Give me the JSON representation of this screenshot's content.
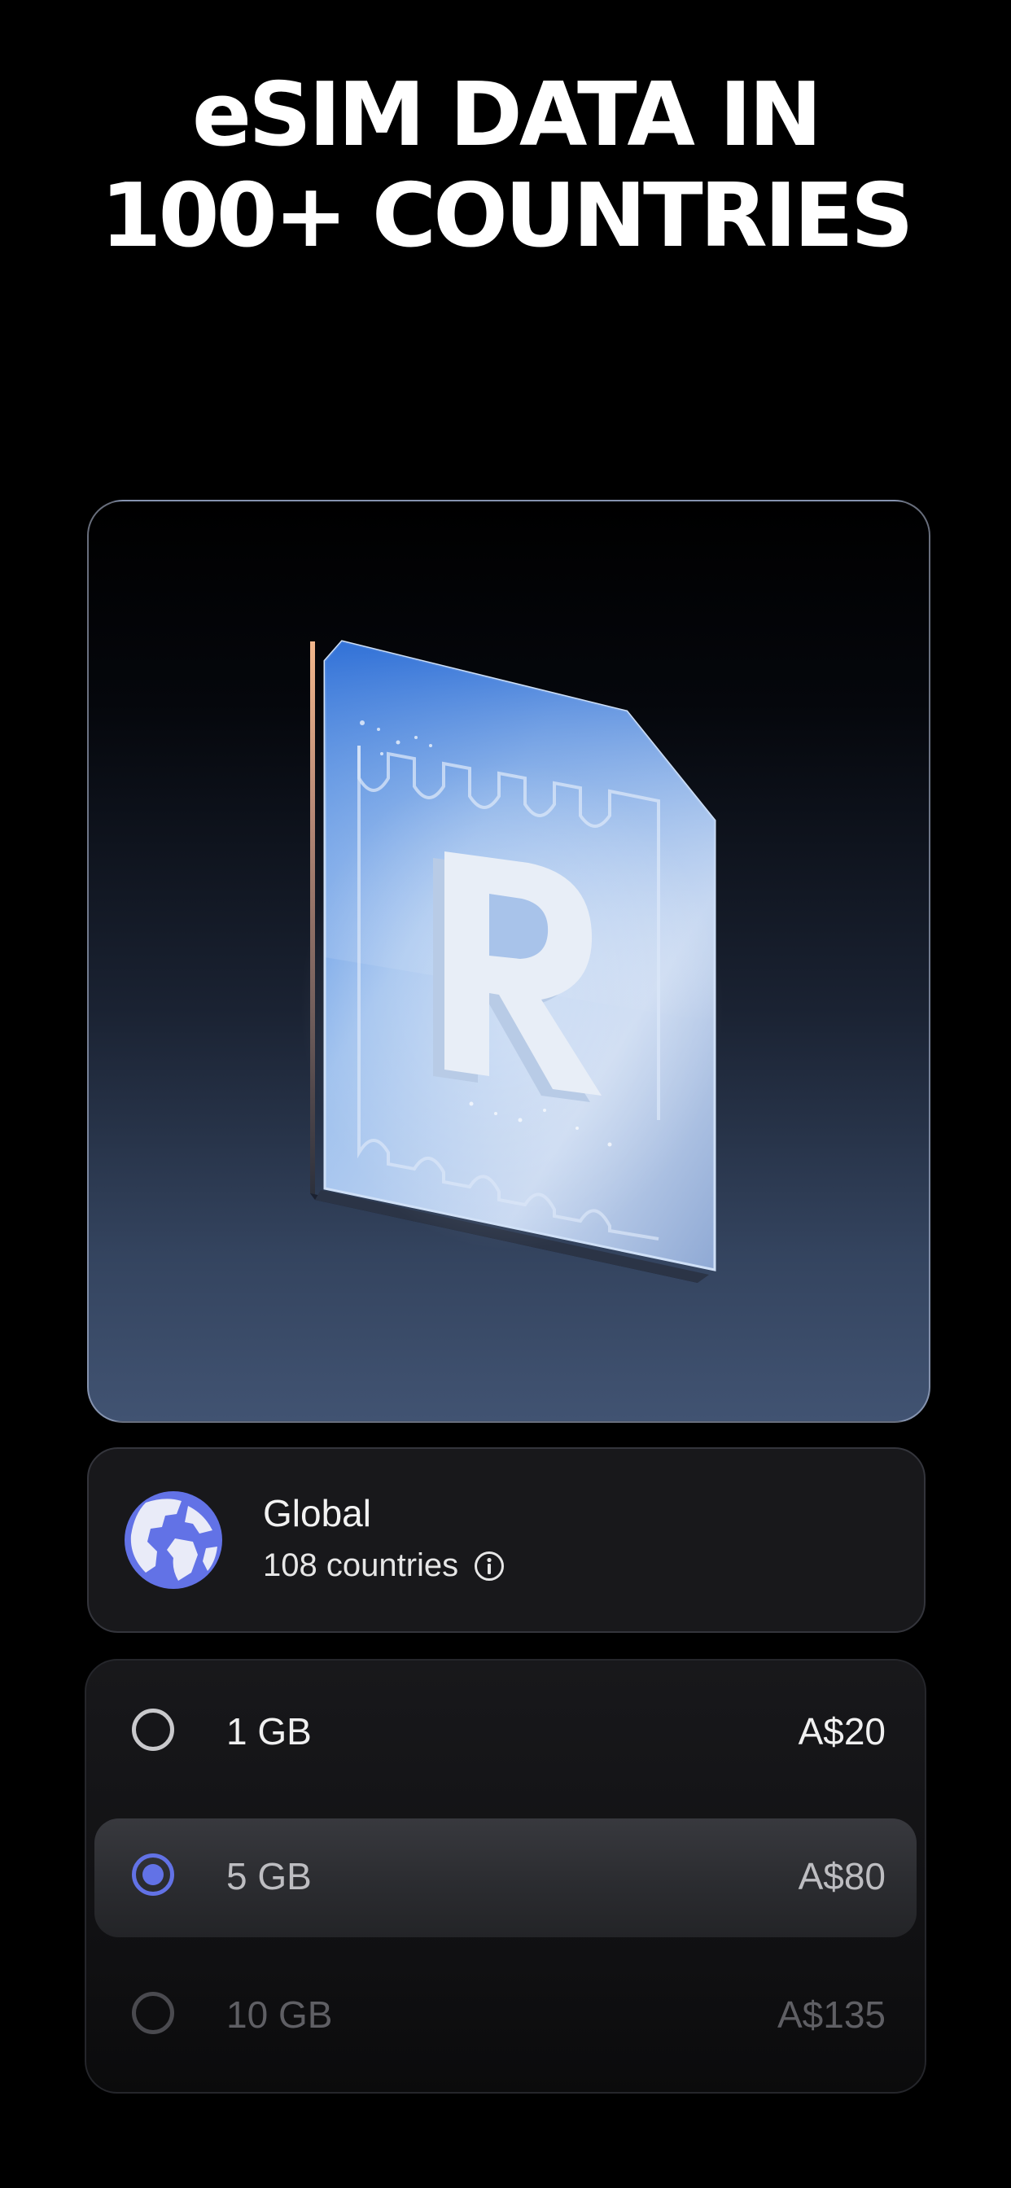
{
  "headline": {
    "line1": "eSIM DATA IN",
    "line2": "100+ COUNTRIES"
  },
  "hero": {
    "logo_letter": "R",
    "colors": {
      "card_glass": "#8fb6ee",
      "card_edge": "#4b8fe8"
    }
  },
  "region": {
    "icon": "globe-icon",
    "name": "Global",
    "countries": "108 countries",
    "info_icon": "info-icon"
  },
  "plans": [
    {
      "size": "1 GB",
      "price": "A$20",
      "selected": false
    },
    {
      "size": "5 GB",
      "price": "A$80",
      "selected": true
    },
    {
      "size": "10 GB",
      "price": "A$135",
      "selected": false
    }
  ],
  "colors": {
    "accent": "#6272e6",
    "background": "#000000",
    "card": "#18181b",
    "globe_land": "#e9ebf8"
  }
}
